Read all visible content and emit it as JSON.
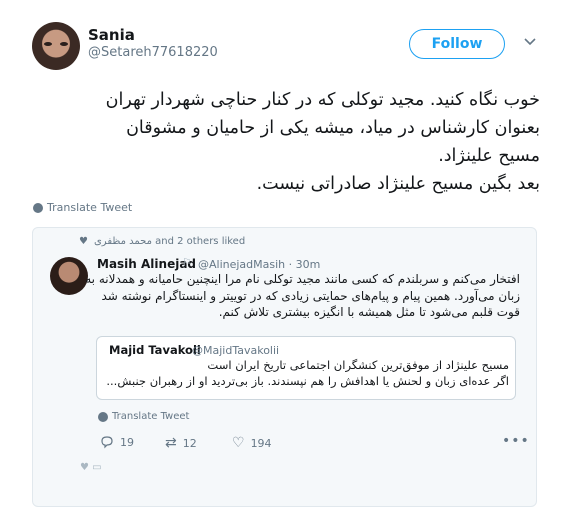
{
  "user": {
    "name": "Sania",
    "handle": "@Setareh77618220",
    "follow_label": "Follow"
  },
  "tweet": {
    "lines": [
      "خوب نگاه کنید. مجید توکلی که در کنار حناچی شهردار تهران",
      "بعنوان کارشناس در میاد، میشه یکی از حامیان و مشوقان",
      "مسیح علینژاد.",
      "بعد بگین مسیح علینژاد صادراتی نیست."
    ],
    "translate_label": "Translate Tweet"
  },
  "quoted": {
    "liked_by": "محمد مظفری and 2 others liked",
    "name": "Masih Alinejad",
    "handle": "@AlinejadMasih · 30m",
    "lines": [
      "افتخار می‌کنم و سربلندم که کسی مانند مجید توکلی نام مرا اینچنین حامیانه و همدلانه به",
      "زبان می‌آورد. همین پیام و پیام‌های حمایتی زیادی که در توییتر و اینستاگرام نوشته شد",
      "قوت قلبم می‌شود تا  مثل همیشه با انگیزه بیشتری تلاش کنم."
    ],
    "inner": {
      "name": "Majid Tavakoli",
      "handle": "@MajidTavakolii",
      "lines": [
        "مسیح علینژاد از موفق‌ترین کنشگران اجتماعی تاریخ ایران است",
        "اگر عده‌ای زبان و لحنش یا اهدافش را هم نپسندند. باز بی‌تردید او از رهبران جنبش..."
      ]
    },
    "translate_label": "Translate Tweet",
    "reply_count": "19",
    "retweet_count": "12",
    "like_count": "194"
  },
  "icons": {
    "chevron": "chevron-down-icon",
    "globe": "globe-icon",
    "reply": "reply-icon",
    "retweet": "retweet-icon",
    "like": "heart-icon",
    "more": "more-icon"
  },
  "colors": {
    "accent": "#1da1f2",
    "muted": "#657786",
    "card_bg": "#f5f8fa"
  }
}
